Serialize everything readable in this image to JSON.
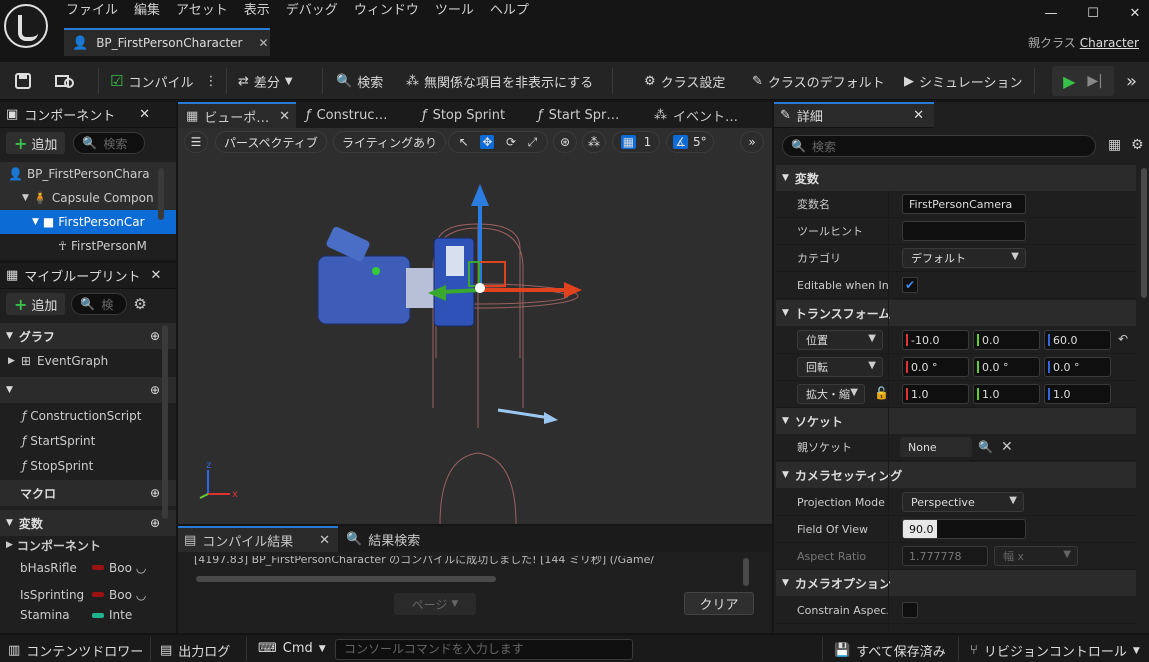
{
  "menu": [
    "ファイル",
    "編集",
    "アセット",
    "表示",
    "デバッグ",
    "ウィンドウ",
    "ツール",
    "ヘルプ"
  ],
  "window": {
    "minimize": "—",
    "maximize": "☐",
    "close": "✕"
  },
  "doc_tab": {
    "title": "BP_FirstPersonCharacter",
    "close": "✕"
  },
  "parent_class": {
    "label": "親クラス",
    "value": "Character"
  },
  "toolbar": {
    "compile": "コンパイル",
    "diff": "差分",
    "find": "検索",
    "hide_unrelated": "無関係な項目を非表示にする",
    "class_settings": "クラス設定",
    "class_defaults": "クラスのデフォルト",
    "simulation": "シミュレーション"
  },
  "components": {
    "title": "コンポーネント",
    "add": "追加",
    "search_placeholder": "検索",
    "tree": [
      "BP_FirstPersonChara",
      "Capsule Compon",
      "FirstPersonCar",
      "FirstPersonM"
    ]
  },
  "blueprint": {
    "title": "マイブループリント",
    "add": "追加",
    "search_placeholder": "検",
    "graph_header": "グラフ",
    "event_graph": "EventGraph",
    "functions": [
      "ConstructionScript",
      "StartSprint",
      "StopSprint"
    ],
    "macro_header": "マクロ",
    "variables_header": "変数",
    "components_header": "コンポーネント",
    "variables": [
      {
        "name": "bHasRifle",
        "type": "Boo"
      },
      {
        "name": "IsSprinting",
        "type": "Boo"
      },
      {
        "name": "Stamina",
        "type": "Inte"
      }
    ]
  },
  "viewport_tabs": [
    "ビューポ…",
    "Construc…",
    "Stop Sprint",
    "Start Spr…",
    "イベント…"
  ],
  "viewport": {
    "perspective": "パースペクティブ",
    "lighting": "ライティングあり",
    "grid_snap": "1",
    "rot_snap": "5°"
  },
  "compile_panel": {
    "tab": "コンパイル結果",
    "search_tab": "結果検索",
    "log": "[4197.83] BP_FirstPersonCharacter のコンパイルに成功しました! [144 ミリ秒] (/Game/",
    "page": "ページ",
    "clear": "クリア"
  },
  "details": {
    "title": "詳細",
    "search_placeholder": "検索",
    "variable_header": "変数",
    "var_name_label": "変数名",
    "var_name_value": "FirstPersonCamera",
    "tooltip_label": "ツールヒント",
    "tooltip_value": "",
    "category_label": "カテゴリ",
    "category_value": "デフォルト",
    "editable_label": "Editable when In...",
    "editable_checked": true,
    "transform_header": "トランスフォーム",
    "location_label": "位置",
    "location": [
      "-10.0",
      "0.0",
      "60.0"
    ],
    "rotation_label": "回転",
    "rotation": [
      "0.0 °",
      "0.0 °",
      "0.0 °"
    ],
    "scale_label": "拡大・縮",
    "scale": [
      "1.0",
      "1.0",
      "1.0"
    ],
    "socket_header": "ソケット",
    "parent_socket_label": "親ソケット",
    "parent_socket_value": "None",
    "camera_settings_header": "カメラセッティング",
    "projection_label": "Projection Mode",
    "projection_value": "Perspective",
    "fov_label": "Field Of View",
    "fov_value": "90.0 °",
    "aspect_label": "Aspect Ratio",
    "aspect_value": "1.777778",
    "aspect_unit": "幅 x",
    "camera_options_header": "カメラオプション",
    "constrain_label": "Constrain Aspec..."
  },
  "statusbar": {
    "content_drawer": "コンテンツドロワー",
    "output_log": "出力ログ",
    "cmd": "Cmd",
    "console_placeholder": "コンソールコマンドを入力します",
    "save_all": "すべて保存済み",
    "revision": "リビジョンコントロール"
  },
  "colors": {
    "accent": "#2a7bd6",
    "selection": "#0d6bd6",
    "add_green": "#38c04a",
    "axis_x": "#d33",
    "axis_y": "#6c3",
    "axis_z": "#36d"
  }
}
